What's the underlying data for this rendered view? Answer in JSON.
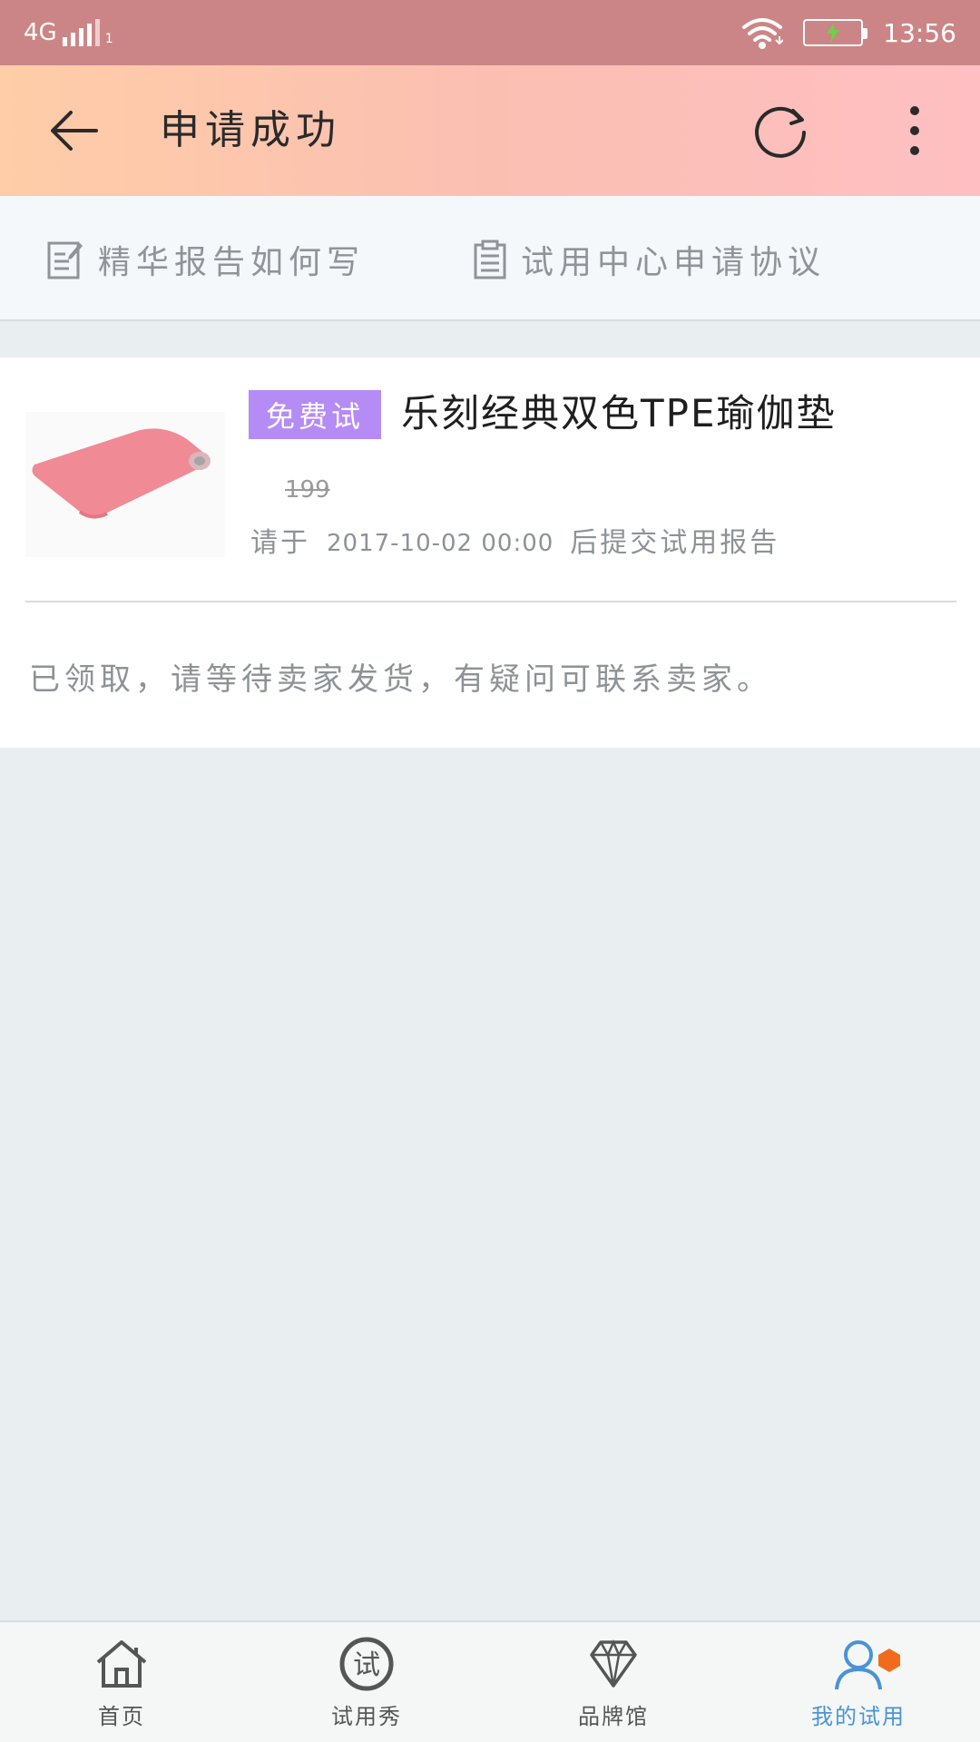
{
  "status_bar": {
    "network": "4G",
    "sim": "1",
    "time": "13:56"
  },
  "header": {
    "title": "申请成功"
  },
  "shortcuts": [
    {
      "label": "精华报告如何写"
    },
    {
      "label": "试用中心申请协议"
    }
  ],
  "product": {
    "badge": "免费试",
    "title": "乐刻经典双色TPE瑜伽垫",
    "price": "199",
    "deadline_prefix": "请于",
    "deadline_time": "2017-10-02 00:00",
    "deadline_suffix": "后提交试用报告",
    "status_note": "已领取，请等待卖家发货，有疑问可联系卖家。"
  },
  "bottom_nav": [
    {
      "label": "首页",
      "icon": "home-icon",
      "active": false
    },
    {
      "label": "试用秀",
      "icon": "try-show-icon",
      "active": false
    },
    {
      "label": "品牌馆",
      "icon": "diamond-icon",
      "active": false
    },
    {
      "label": "我的试用",
      "icon": "user-icon",
      "active": true
    }
  ],
  "colors": {
    "status_bar": "#cc8586",
    "header_gradient_start": "#ffcda8",
    "header_gradient_end": "#ffbfc2",
    "badge": "#b58bf5",
    "active_nav": "#4a93d6",
    "notify_dot": "#f26b1d",
    "background": "#e9eef1"
  }
}
